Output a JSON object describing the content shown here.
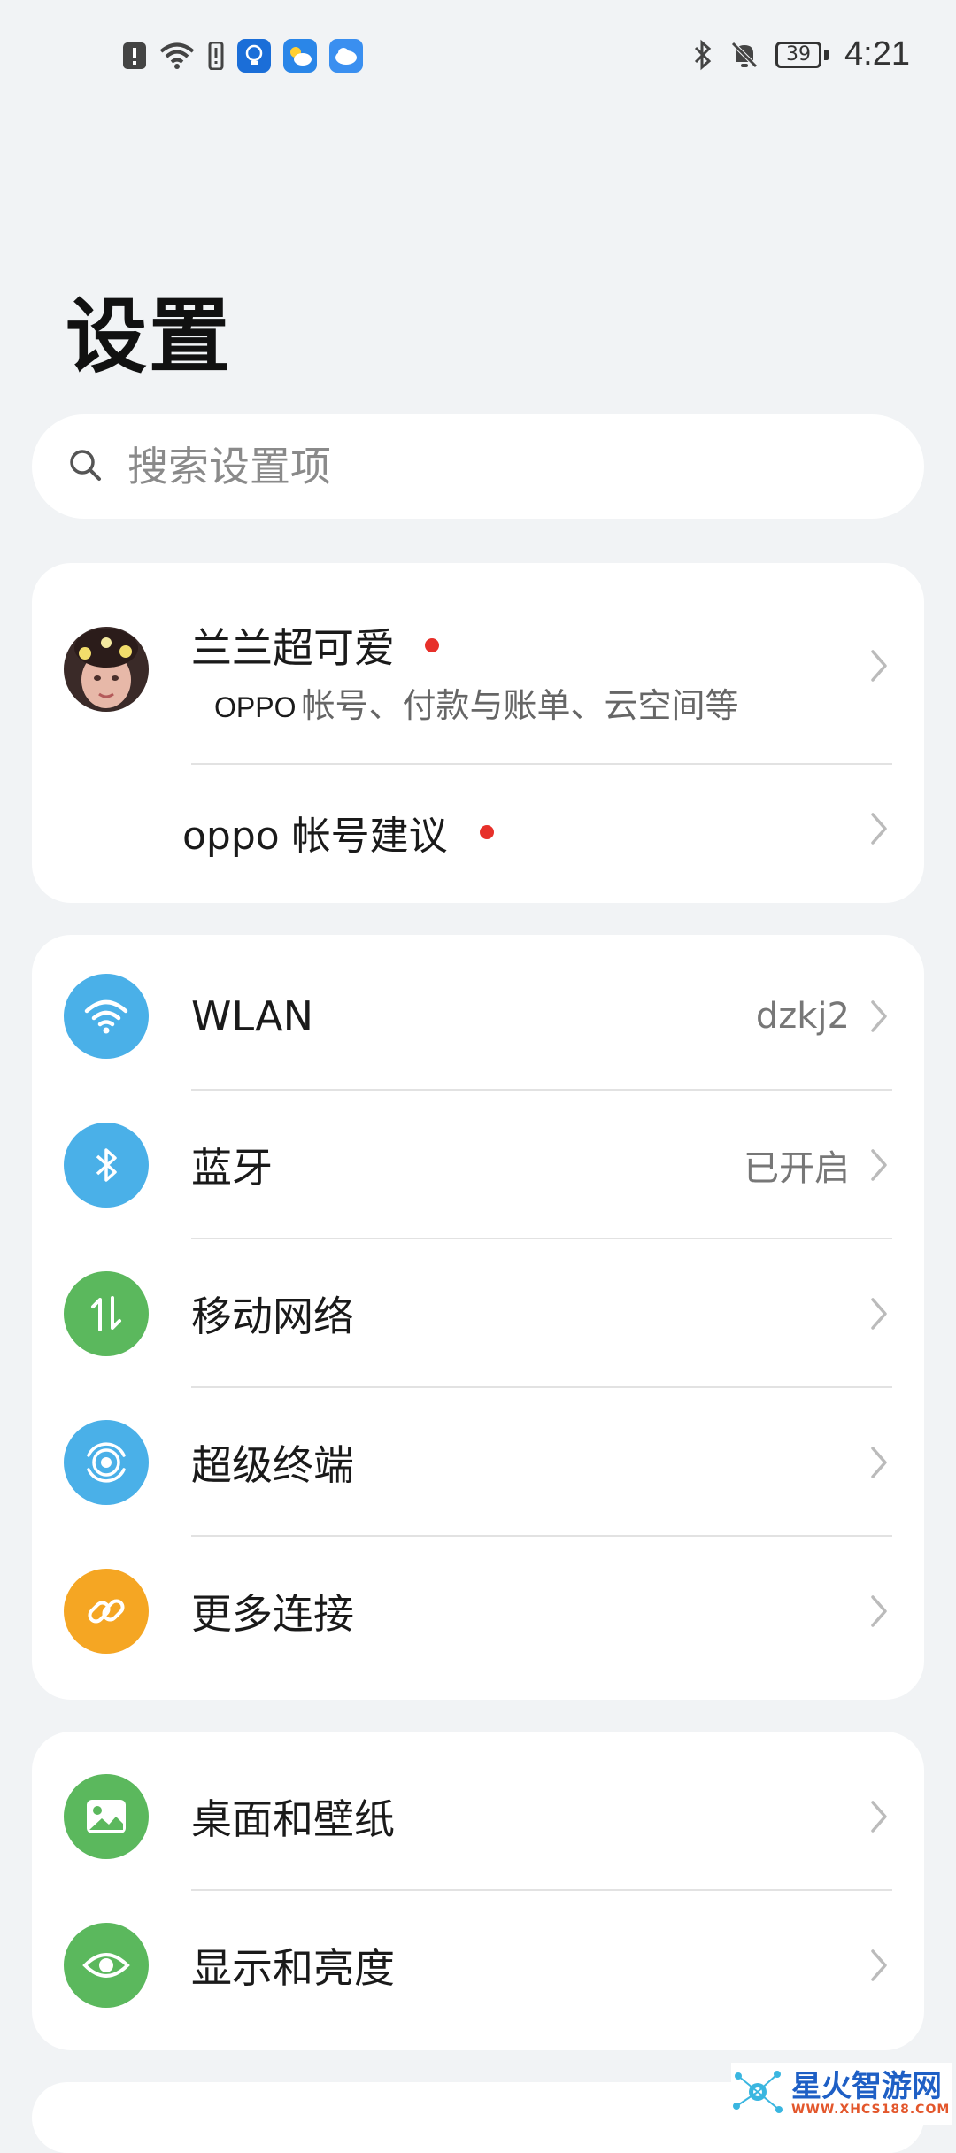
{
  "status_bar": {
    "time": "4:21",
    "battery": "39",
    "left_icons": [
      "alert-icon",
      "wifi-icon",
      "sim-alert-icon",
      "tips-app-icon",
      "weather-app-icon",
      "cloud-app-icon"
    ],
    "right_icons": [
      "bluetooth-icon",
      "mute-bell-icon",
      "battery-icon"
    ]
  },
  "page": {
    "title": "设置"
  },
  "search": {
    "placeholder": "搜索设置项"
  },
  "account": {
    "name": "兰兰超可爱",
    "subtitle_brand": "OPPO",
    "subtitle_rest": "帐号、付款与账单、云空间等",
    "suggestion_label": "oppo 帐号建议",
    "notification_color": "#e7302a"
  },
  "connectivity": {
    "items": [
      {
        "label": "WLAN",
        "value": "dzkj2",
        "icon": "wifi-icon",
        "color": "#4ab0e8"
      },
      {
        "label": "蓝牙",
        "value": "已开启",
        "icon": "bluetooth-icon",
        "color": "#4ab0e8"
      },
      {
        "label": "移动网络",
        "value": "",
        "icon": "mobile-data-icon",
        "color": "#5bb85d"
      },
      {
        "label": "超级终端",
        "value": "",
        "icon": "super-device-icon",
        "color": "#4ab0e8"
      },
      {
        "label": "更多连接",
        "value": "",
        "icon": "link-icon",
        "color": "#f5a623"
      }
    ]
  },
  "display": {
    "items": [
      {
        "label": "桌面和壁纸",
        "icon": "wallpaper-icon",
        "color": "#5bb85d"
      },
      {
        "label": "显示和亮度",
        "icon": "eye-icon",
        "color": "#5bb85d"
      }
    ]
  },
  "watermark": {
    "title": "星火智游网",
    "url": "WWW.XHCS188.COM"
  }
}
